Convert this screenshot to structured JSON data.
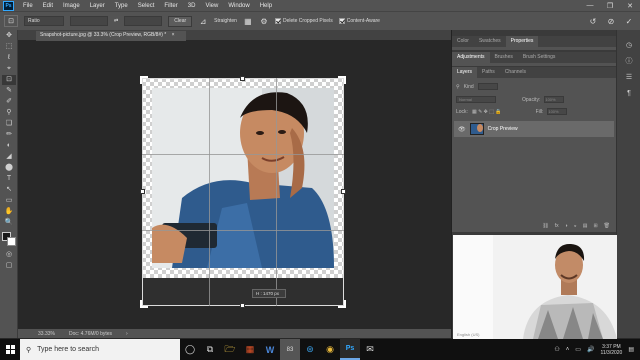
{
  "menubar": {
    "logo": "Ps",
    "items": [
      "File",
      "Edit",
      "Image",
      "Layer",
      "Type",
      "Select",
      "Filter",
      "3D",
      "View",
      "Window",
      "Help"
    ],
    "window_controls": [
      "—",
      "❐",
      "✕"
    ]
  },
  "options": {
    "ratio_label": "Ratio",
    "clear_label": "Clear",
    "straighten_label": "Straighten",
    "delete_cropped_label": "Delete Cropped Pixels",
    "content_aware_label": "Content-Aware",
    "reset_icon": "↺",
    "cancel_icon": "⊘",
    "commit_icon": "✓"
  },
  "tools": [
    "✥",
    "⬚",
    "ℓ",
    "⌖",
    "⊡",
    "✎",
    "✐",
    "⚲",
    "❏",
    "✏",
    "◐",
    "◢",
    "⬤",
    "T",
    "↖",
    "▭",
    "✋",
    "🔍"
  ],
  "document": {
    "tab_title": "Snapshot-picture.jpg @ 33.3% (Crop Preview, RGB/8#) *",
    "close_icon": "×"
  },
  "crop": {
    "hint": "H : 1470 px"
  },
  "status": {
    "zoom": "33.33%",
    "doc": "Doc: 4.76M/0 bytes"
  },
  "panels": {
    "top_tabs": [
      "Color",
      "Swatches",
      "Properties"
    ],
    "top_active": "Properties",
    "mid_tabs": [
      "Adjustments",
      "Brushes",
      "Brush Settings"
    ],
    "mid_active": "Adjustments",
    "layers_tabs": [
      "Layers",
      "Paths",
      "Channels"
    ],
    "layers_active": "Layers",
    "kind_label": "Kind",
    "blend_mode": "Normal",
    "opacity_label": "Opacity:",
    "opacity_value": "100%",
    "lock_label": "Lock:",
    "fill_label": "Fill:",
    "fill_value": "100%",
    "layer_name": "Crop Preview",
    "bottom_icons": [
      "⛓",
      "fx",
      "◑",
      "◒",
      "▤",
      "⊞",
      "🗑"
    ]
  },
  "webcam": {
    "label": "English (US)"
  },
  "taskbar": {
    "search_placeholder": "Type here to search",
    "icons": [
      "◯",
      "⧉",
      "🗁",
      "▦",
      "W",
      "83",
      "⊛",
      "◉",
      "Ps",
      "✉"
    ],
    "time": "3:37 PM",
    "date": "11/3/2020"
  },
  "colors": {
    "accent": "#31a8ff",
    "ui_dark": "#535353",
    "canvas": "#282828"
  }
}
